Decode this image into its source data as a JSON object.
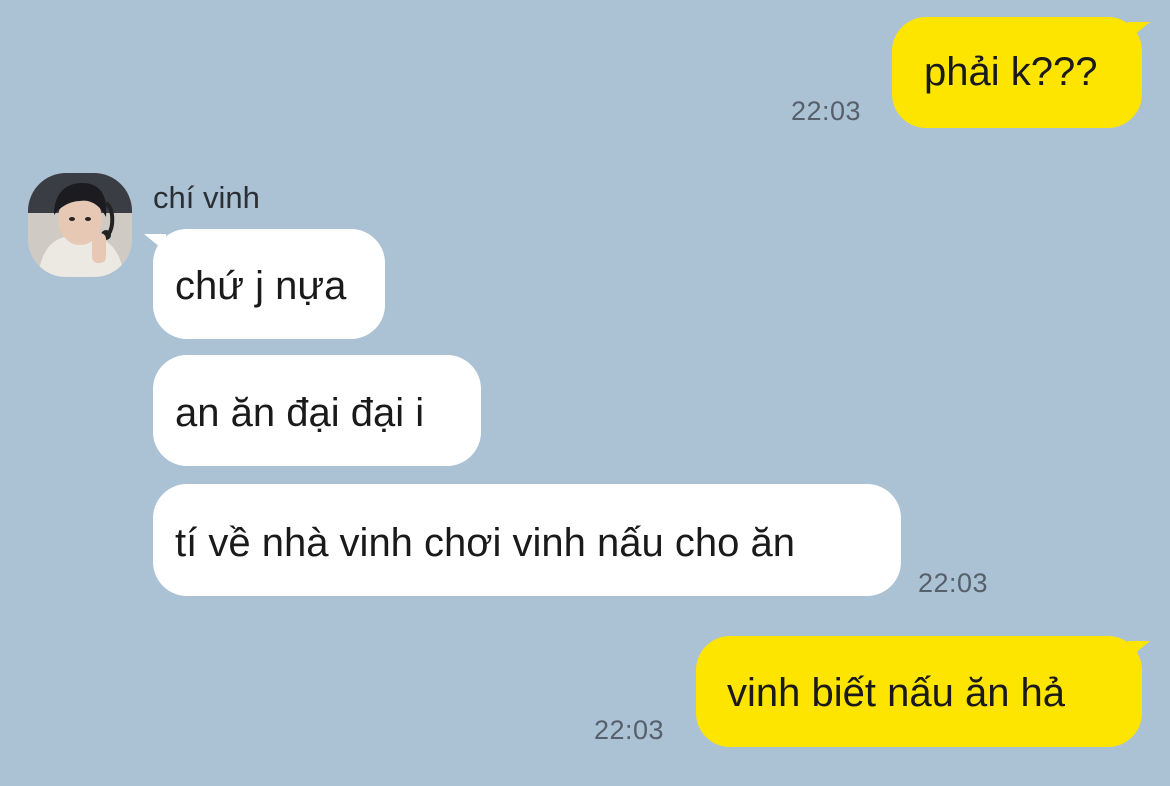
{
  "conversation": {
    "sender_name": "chí vinh",
    "messages": [
      {
        "text": "phải k???",
        "time": "22:03",
        "direction": "out"
      },
      {
        "text": "chứ j nựa",
        "direction": "in"
      },
      {
        "text": "an ăn đại đại i",
        "direction": "in"
      },
      {
        "text": "tí về nhà vinh chơi vinh nấu cho ăn",
        "time": "22:03",
        "direction": "in"
      },
      {
        "text": "vinh biết nấu ăn hả",
        "time": "22:03",
        "direction": "out"
      }
    ]
  },
  "colors": {
    "background": "#abc1d4",
    "outgoing_bubble": "#fee500",
    "incoming_bubble": "#ffffff",
    "timestamp": "#56606c"
  },
  "icons": {
    "avatar": "user-photo-avatar"
  }
}
